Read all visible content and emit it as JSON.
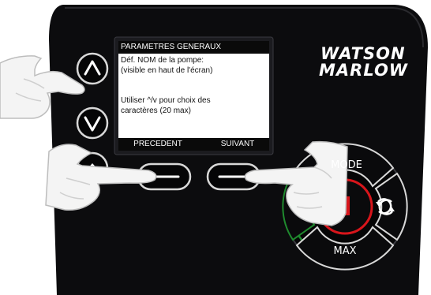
{
  "screen": {
    "header": "PARAMETRES GENERAUX",
    "lines": [
      "Déf. NOM de la pompe:",
      "(visible en haut de l'écran)",
      "Utiliser ^/v pour choix des",
      "caractères (20 max)"
    ],
    "softkeys": {
      "left": "PRECEDENT",
      "right": "SUIVANT"
    }
  },
  "brand": {
    "line1": "WATSON",
    "line2": "MARLOW"
  },
  "keypad": {
    "mode_label": "MODE",
    "max_label": "MAX"
  },
  "icons": {
    "up": "chevron-up-icon",
    "down": "chevron-down-icon",
    "home": "home-icon",
    "direction": "rotate-direction-icon",
    "stop": "stop-icon"
  },
  "colors": {
    "panel": "#0c0c0e",
    "stop_red": "#d8151b",
    "start_green": "#1f8a2e",
    "skin": "#f4f4f4"
  }
}
